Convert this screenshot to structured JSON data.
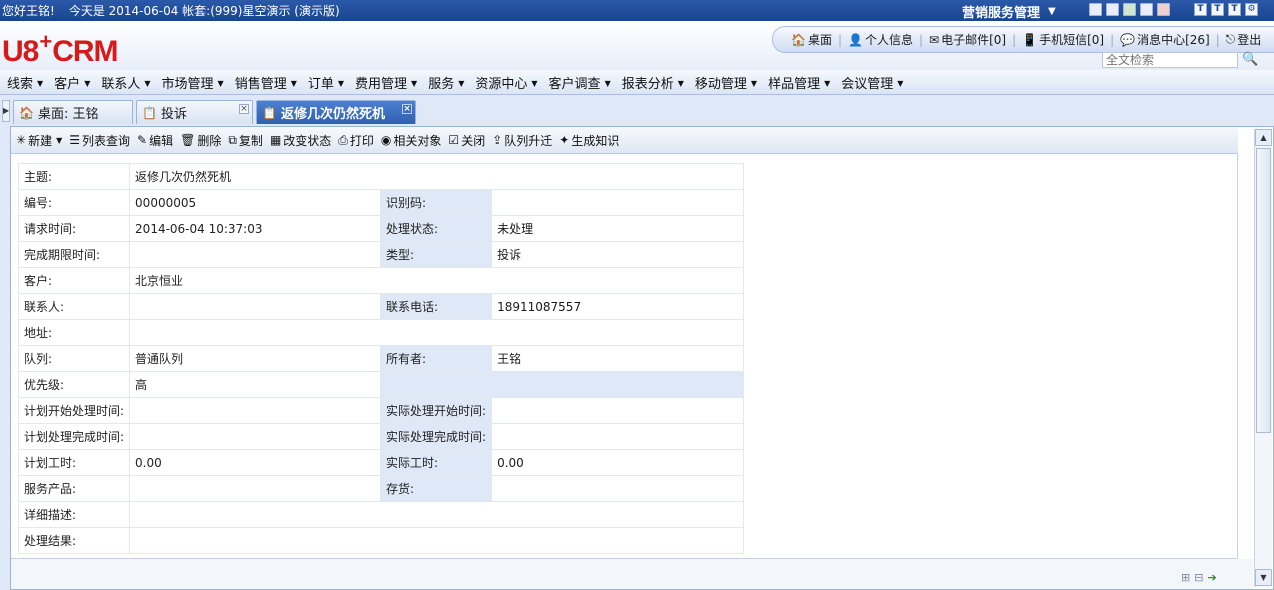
{
  "topbar": {
    "greeting": "您好王铭!",
    "today": "今天是  2014-06-04 帐套:(999)星空演示 (演示版)",
    "module": "营销服务管理",
    "win_buttons": [
      "layout-1-icon",
      "layout-2-icon",
      "layout-3-icon",
      "layout-4-icon",
      "layout-5-icon"
    ],
    "ctl_buttons": [
      "T",
      "T",
      "T"
    ]
  },
  "header": {
    "logo_left": "U8",
    "logo_plus": "+",
    "logo_right": "CRM",
    "quick": [
      {
        "label": "桌面",
        "icon": "home-icon"
      },
      {
        "label": "个人信息",
        "icon": "user-icon"
      },
      {
        "label": "电子邮件[0]",
        "icon": "mail-icon"
      },
      {
        "label": "手机短信[0]",
        "icon": "phone-icon"
      },
      {
        "label": "消息中心[26]",
        "icon": "message-icon"
      },
      {
        "label": "登出",
        "icon": "logout-icon"
      }
    ],
    "search_placeholder": "全文检索"
  },
  "menu": [
    "线索",
    "客户",
    "联系人",
    "市场管理",
    "销售管理",
    "订单",
    "费用管理",
    "服务",
    "资源中心",
    "客户调查",
    "报表分析",
    "移动管理",
    "样品管理",
    "会议管理"
  ],
  "tabs": [
    {
      "label": "桌面: 王铭",
      "icon": "home-icon",
      "closable": false
    },
    {
      "label": "投诉",
      "icon": "form-icon",
      "closable": true
    },
    {
      "label": "返修几次仍然死机",
      "icon": "form-icon",
      "closable": true
    }
  ],
  "toolbar": [
    "新建",
    "列表查询",
    "编辑",
    "删除",
    "复制",
    "改变状态",
    "打印",
    "相关对象",
    "关闭",
    "队列升迁",
    "生成知识"
  ],
  "form": {
    "subject_label": "主题:",
    "subject": "返修几次仍然死机",
    "code_label": "编号:",
    "code": "00000005",
    "idcode_label": "识别码:",
    "idcode": "",
    "request_time_label": "请求时间:",
    "request_time": "2014-06-04 10:37:03",
    "status_label": "处理状态:",
    "status": "未处理",
    "deadline_label": "完成期限时间:",
    "deadline": "",
    "type_label": "类型:",
    "type": "投诉",
    "customer_label": "客户:",
    "customer": "北京恒业",
    "contact_label": "联系人:",
    "contact": "",
    "phone_label": "联系电话:",
    "phone": "18911087557",
    "address_label": "地址:",
    "address": "",
    "queue_label": "队列:",
    "queue": "普通队列",
    "owner_label": "所有者:",
    "owner": "王铭",
    "priority_label": "优先级:",
    "priority": "高",
    "plan_start_label": "计划开始处理时间:",
    "plan_start": "",
    "actual_start_label": "实际处理开始时间:",
    "actual_start": "",
    "plan_end_label": "计划处理完成时间:",
    "plan_end": "",
    "actual_end_label": "实际处理完成时间:",
    "actual_end": "",
    "plan_hours_label": "计划工时:",
    "plan_hours": "0.00",
    "actual_hours_label": "实际工时:",
    "actual_hours": "0.00",
    "product_label": "服务产品:",
    "product": "",
    "stock_label": "存货:",
    "stock": "",
    "detail_label": "详细描述:",
    "detail": "",
    "result_label": "处理结果:",
    "result": ""
  }
}
